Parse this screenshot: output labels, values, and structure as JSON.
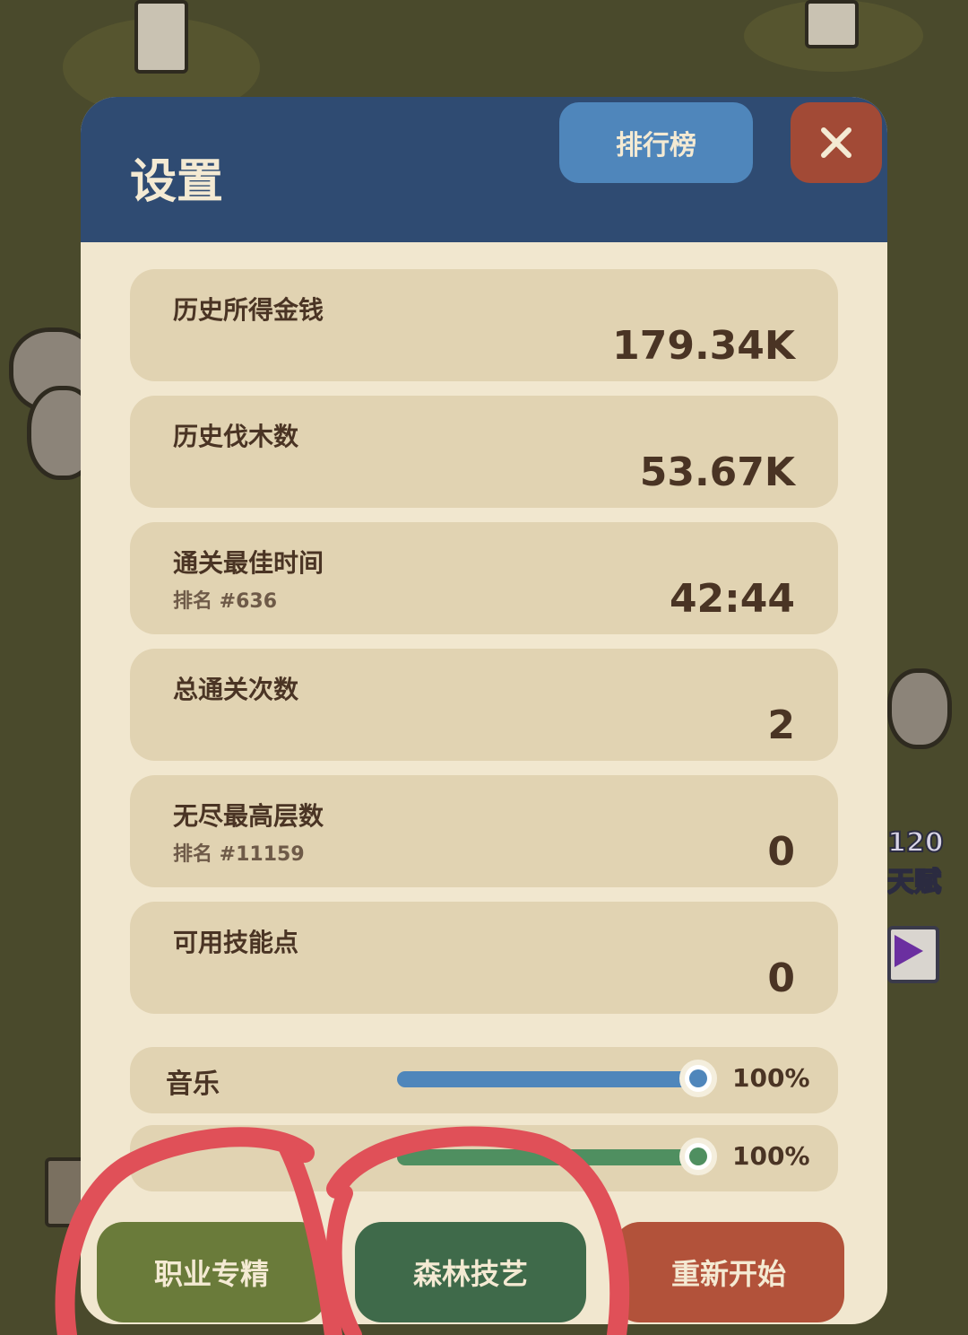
{
  "header": {
    "title": "设置",
    "leaderboard_label": "排行榜",
    "close_label": "✕"
  },
  "stats": [
    {
      "label": "历史所得金钱",
      "sub": "",
      "value": "179.34K"
    },
    {
      "label": "历史伐木数",
      "sub": "",
      "value": "53.67K"
    },
    {
      "label": "通关最佳时间",
      "sub": "排名 #636",
      "value": "42:44"
    },
    {
      "label": "总通关次数",
      "sub": "",
      "value": "2"
    },
    {
      "label": "无尽最高层数",
      "sub": "排名 #11159",
      "value": "0"
    },
    {
      "label": "可用技能点",
      "sub": "",
      "value": "0"
    }
  ],
  "sliders": [
    {
      "label": "音乐",
      "value": "100%",
      "level": 1.0,
      "color": "#4f86bb"
    },
    {
      "label": "",
      "value": "100%",
      "level": 1.0,
      "color": "#4f8f60"
    }
  ],
  "buttons": {
    "profession": "职业专精",
    "forest_craft": "森林技艺",
    "restart": "重新开始"
  },
  "background": {
    "talent_count": "120",
    "talent_label": "天赋"
  },
  "colors": {
    "header_bg": "#2f4b72",
    "leaderboard_btn": "#4f86bb",
    "close_btn": "#a24a36",
    "profession_btn": "#6a7b3a",
    "forest_btn": "#3f6a4a",
    "restart_btn": "#b2523a",
    "annotation": "#e05058"
  }
}
